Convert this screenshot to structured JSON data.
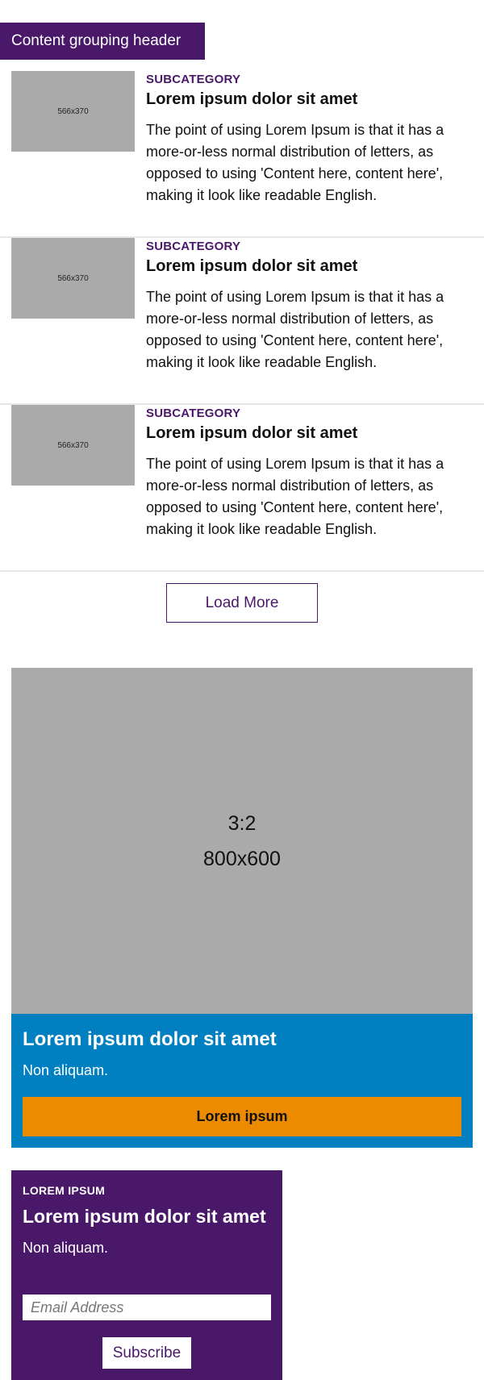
{
  "group_header": "Content grouping header",
  "articles": [
    {
      "thumb_label": "566x370",
      "subcategory": "SUBCATEGORY",
      "title": "Lorem ipsum dolor sit amet",
      "description": "The point of using Lorem Ipsum is that it has a more-or-less normal distribution of letters, as opposed to using 'Content here, content here', making it look like readable English."
    },
    {
      "thumb_label": "566x370",
      "subcategory": "SUBCATEGORY",
      "title": "Lorem ipsum dolor sit amet",
      "description": "The point of using Lorem Ipsum is that it has a more-or-less normal distribution of letters, as opposed to using 'Content here, content here', making it look like readable English."
    },
    {
      "thumb_label": "566x370",
      "subcategory": "SUBCATEGORY",
      "title": "Lorem ipsum dolor sit amet",
      "description": "The point of using Lorem Ipsum is that it has a more-or-less normal distribution of letters, as opposed to using 'Content here, content here', making it look like readable English."
    }
  ],
  "load_more_label": "Load More",
  "promo": {
    "image_ratio": "3:2",
    "image_size": "800x600",
    "title": "Lorem ipsum dolor sit amet",
    "subtitle": "Non aliquam.",
    "button_label": "Lorem ipsum"
  },
  "newsletter": {
    "eyebrow": "LOREM IPSUM",
    "title": "Lorem ipsum dolor sit amet",
    "subtitle": "Non aliquam.",
    "email_placeholder": "Email Address",
    "subscribe_label": "Subscribe"
  },
  "colors": {
    "brand_purple": "#4a1869",
    "promo_blue": "#0080c0",
    "button_orange": "#ec8a00",
    "placeholder_gray": "#aaaaaa"
  }
}
